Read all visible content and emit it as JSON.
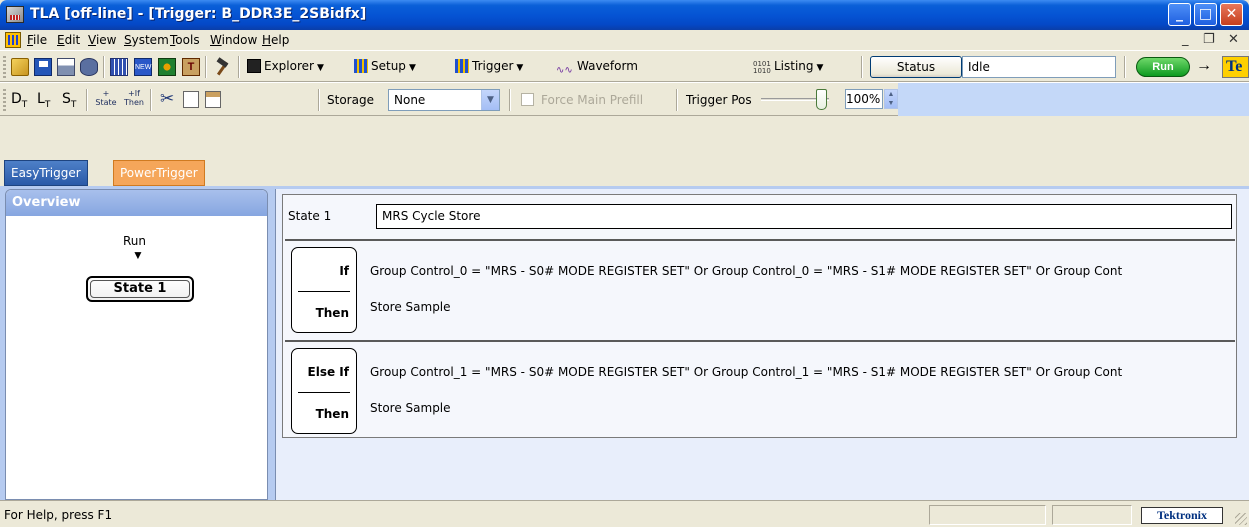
{
  "window": {
    "title": "TLA [off-line] - [Trigger: B_DDR3E_2SBidfx]",
    "minimize_glyph": "_",
    "maximize_glyph": "□",
    "close_glyph": "✕"
  },
  "menu": {
    "items": [
      "File",
      "Edit",
      "View",
      "System",
      "Tools",
      "Window",
      "Help"
    ],
    "mdi_minimize": "_",
    "mdi_restore": "❐",
    "mdi_close": "✕"
  },
  "toolbar1": {
    "explorer": "Explorer",
    "setup": "Setup",
    "trigger": "Trigger",
    "waveform": "Waveform",
    "listing": "Listing",
    "listing_icon_text": "0101\n1010",
    "new_icon_text": "NEW",
    "t_icon_text": "T",
    "status_button": "Status",
    "status_value": "Idle",
    "run_button": "Run",
    "arrow": "→",
    "tek_icon_text": "Te"
  },
  "toolbar2": {
    "d_t": "D",
    "l_t": "L",
    "s_t": "S",
    "sub_t": "T",
    "state_btn": "State",
    "then_btn": "Then",
    "plus_top": "+",
    "if_top": "+If",
    "storage_label": "Storage",
    "storage_value": "None",
    "force_label": "Force Main Prefill",
    "trigger_pos_label": "Trigger Pos",
    "trigger_pos_value": "100%",
    "trigger_pos_percent": 100
  },
  "tabs": {
    "easy": "EasyTrigger",
    "power": "PowerTrigger"
  },
  "overview": {
    "title": "Overview",
    "run_label": "Run",
    "state_box": "State 1"
  },
  "state": {
    "label": "State 1",
    "name": "MRS Cycle Store",
    "clauses": [
      {
        "keyword": "If",
        "then": "Then",
        "condition": "Group Control_0 = \"MRS - S0# MODE REGISTER SET\" Or Group Control_0 = \"MRS - S1# MODE REGISTER SET\" Or Group Cont",
        "action": "Store Sample"
      },
      {
        "keyword": "Else If",
        "then": "Then",
        "condition": "Group Control_1 = \"MRS - S0# MODE REGISTER SET\" Or Group Control_1 = \"MRS - S1# MODE REGISTER SET\" Or Group Cont",
        "action": "Store Sample"
      }
    ]
  },
  "statusbar": {
    "help": "For Help, press F1",
    "logo": "Tektronix"
  },
  "colors": {
    "title_bar": "#0554d4",
    "power_tab": "#f5a65a",
    "easy_tab": "#2a5aa8",
    "run_green": "#0e9a20"
  }
}
